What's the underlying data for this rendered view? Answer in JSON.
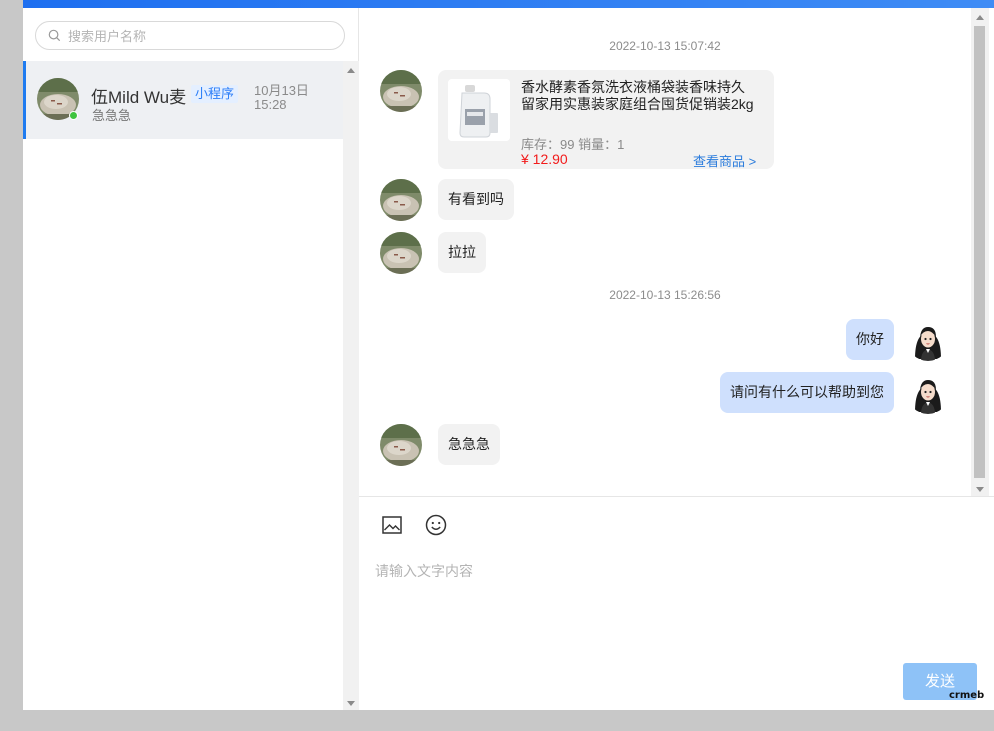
{
  "search": {
    "placeholder": "搜索用户名称"
  },
  "conversations": [
    {
      "name": "伍Mild Wu麦",
      "tag": "小程序",
      "time": "10月13日 15:28",
      "preview": "急急急",
      "online": true
    }
  ],
  "chat": {
    "timestamps": [
      "2022-10-13 15:07:42",
      "2022-10-13 15:26:56"
    ],
    "product": {
      "title": "香水酵素香氛洗衣液桶袋装香味持久留家用实惠装家庭组合囤货促销装2kg",
      "stock": "库存：99 销量：1",
      "price": "¥ 12.90",
      "link": "查看商品 >"
    },
    "messages": [
      {
        "from": "customer",
        "text": "有看到吗"
      },
      {
        "from": "customer",
        "text": "拉拉"
      },
      {
        "from": "agent",
        "text": "你好"
      },
      {
        "from": "agent",
        "text": "请问有什么可以帮助到您"
      },
      {
        "from": "customer",
        "text": "急急急"
      }
    ]
  },
  "composer": {
    "placeholder": "请输入文字内容",
    "send_label": "发送"
  },
  "icons": {
    "image": "image-icon",
    "emoji": "emoji-icon",
    "search": "search-icon"
  },
  "colors": {
    "accent": "#1e7bf0",
    "send": "#8ec2f7",
    "price": "#f21b1b",
    "link": "#2b7cdc",
    "outgoing_bubble": "#cfe0fd"
  },
  "watermark": "crmeb"
}
